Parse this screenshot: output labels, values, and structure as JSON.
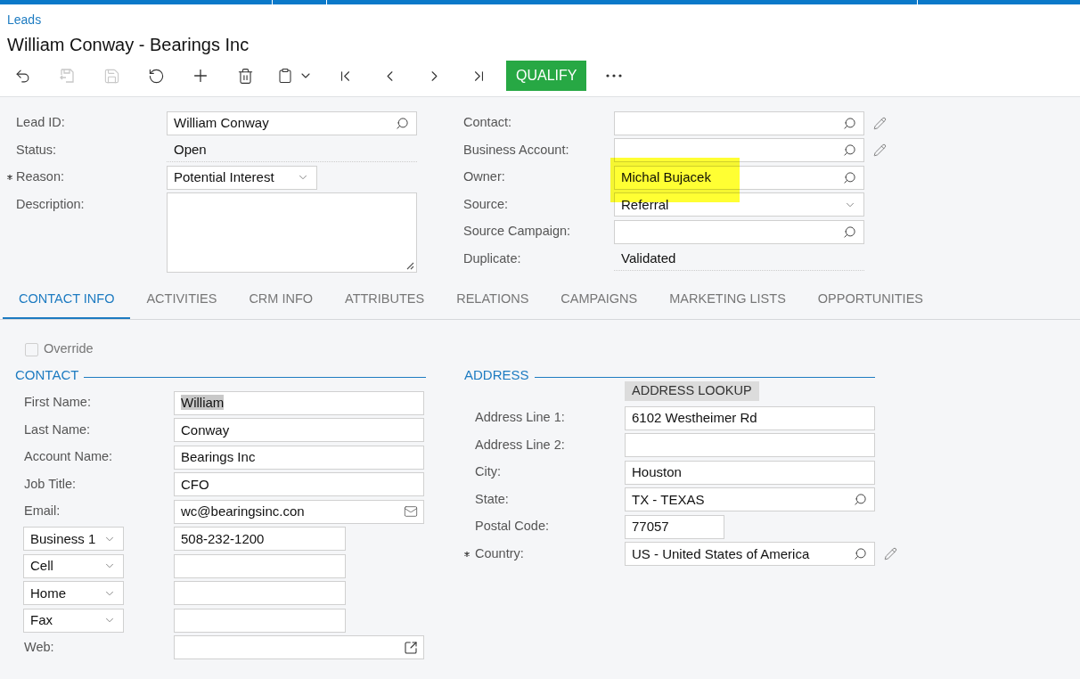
{
  "breadcrumb": "Leads",
  "title": "William Conway - Bearings Inc",
  "toolbar": [
    {
      "kind": "back",
      "disabled": false
    },
    {
      "kind": "save-close",
      "disabled": true
    },
    {
      "kind": "save",
      "disabled": true
    },
    {
      "kind": "cancel",
      "disabled": false
    },
    {
      "kind": "add",
      "disabled": false
    },
    {
      "kind": "delete",
      "disabled": false
    },
    {
      "kind": "clipboard",
      "disabled": false
    },
    {
      "kind": "first",
      "disabled": false
    },
    {
      "kind": "previous",
      "disabled": false
    },
    {
      "kind": "next",
      "disabled": false
    },
    {
      "kind": "last",
      "disabled": false
    },
    {
      "kind": "primary",
      "label": "QUALIFY",
      "disabled": false
    },
    {
      "kind": "more",
      "disabled": false
    }
  ],
  "summary": {
    "left": [
      {
        "label": "Lead ID:",
        "kind": "lookup",
        "value": "William Conway",
        "required": false,
        "has_edit": false,
        "highlighted": false
      },
      {
        "label": "Status:",
        "kind": "readonly",
        "value": "Open",
        "required": false,
        "has_edit": false,
        "highlighted": false
      },
      {
        "label": "Reason:",
        "kind": "dropdown",
        "value": "Potential Interest",
        "required": true,
        "has_edit": false,
        "highlighted": false
      },
      {
        "label": "Description:",
        "kind": "textarea",
        "required": false,
        "has_edit": false,
        "highlighted": false
      }
    ],
    "right": [
      {
        "label": "Contact:",
        "kind": "lookup",
        "required": false,
        "has_edit": true,
        "highlighted": false
      },
      {
        "label": "Business Account:",
        "kind": "lookup",
        "required": false,
        "has_edit": true,
        "highlighted": false
      },
      {
        "label": "Owner:",
        "kind": "lookup",
        "value": "Michal Bujacek",
        "required": false,
        "has_edit": false,
        "highlighted": true
      },
      {
        "label": "Source:",
        "kind": "dropdown",
        "value": "Referral",
        "required": false,
        "has_edit": false,
        "highlighted": false
      },
      {
        "label": "Source Campaign:",
        "kind": "lookup",
        "required": false,
        "has_edit": false,
        "highlighted": false
      },
      {
        "label": "Duplicate:",
        "kind": "readonly",
        "value": "Validated",
        "required": false,
        "has_edit": false,
        "highlighted": false
      }
    ]
  },
  "tabs": [
    {
      "label": "CONTACT INFO",
      "selected": true
    },
    {
      "label": "ACTIVITIES",
      "selected": false
    },
    {
      "label": "CRM INFO",
      "selected": false
    },
    {
      "label": "ATTRIBUTES",
      "selected": false
    },
    {
      "label": "RELATIONS",
      "selected": false
    },
    {
      "label": "CAMPAIGNS",
      "selected": false
    },
    {
      "label": "MARKETING LISTS",
      "selected": false
    },
    {
      "label": "OPPORTUNITIES",
      "selected": false
    }
  ],
  "override": {
    "label": "Override",
    "checked": false
  },
  "contact": {
    "heading": "CONTACT",
    "fields": [
      {
        "label": "First Name:",
        "kind": "text",
        "value": "William",
        "text_selected": true
      },
      {
        "label": "Last Name:",
        "kind": "text",
        "value": "Conway",
        "text_selected": false
      },
      {
        "label": "Account Name:",
        "kind": "text",
        "value": "Bearings Inc",
        "text_selected": false
      },
      {
        "label": "Job Title:",
        "kind": "text",
        "value": "CFO",
        "text_selected": false
      },
      {
        "label": "Email:",
        "kind": "email",
        "value": "wc@bearingsinc.con",
        "text_selected": false
      },
      {
        "type_label": "Business 1",
        "kind": "phone",
        "value": "508-232-1200",
        "text_selected": false
      },
      {
        "type_label": "Cell",
        "kind": "phone"
      },
      {
        "type_label": "Home",
        "kind": "phone"
      },
      {
        "type_label": "Fax",
        "kind": "phone"
      },
      {
        "label": "Web:",
        "kind": "link"
      }
    ]
  },
  "address": {
    "heading": "ADDRESS",
    "lookup_button": "ADDRESS LOOKUP",
    "fields": [
      {
        "label": "Address Line 1:",
        "kind": "text",
        "value": "6102 Westheimer Rd",
        "required": false,
        "has_edit": false
      },
      {
        "label": "Address Line 2:",
        "kind": "text",
        "required": false,
        "has_edit": false
      },
      {
        "label": "City:",
        "kind": "text",
        "value": "Houston",
        "required": false,
        "has_edit": false
      },
      {
        "label": "State:",
        "kind": "lookup",
        "value": "TX - TEXAS",
        "required": false,
        "has_edit": false
      },
      {
        "label": "Postal Code:",
        "kind": "short",
        "value": "77057",
        "required": false,
        "has_edit": false
      },
      {
        "label": "Country:",
        "kind": "lookup",
        "value": "US - United States of America",
        "required": true,
        "has_edit": true
      }
    ]
  }
}
